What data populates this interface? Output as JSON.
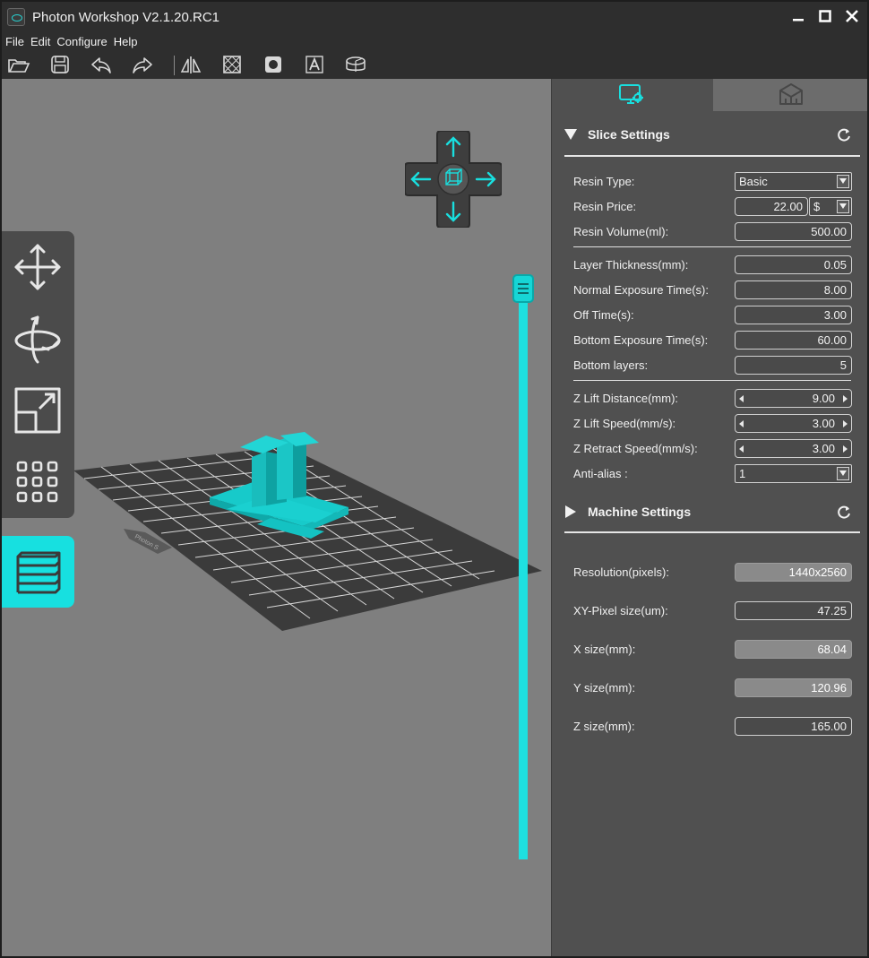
{
  "window": {
    "title": "Photon Workshop V2.1.20.RC1"
  },
  "menu": [
    "File",
    "Edit",
    "Configure",
    "Help"
  ],
  "toolbar": {
    "buttons": [
      "open-folder-icon",
      "save-icon",
      "undo-icon",
      "redo-icon",
      "mirror-icon",
      "hollow-icon",
      "punch-hole-icon",
      "text-icon",
      "slice-icon"
    ]
  },
  "viewport": {
    "plate_label": "Photon S",
    "accent": "#17e0e0",
    "left_tools": [
      "move-icon",
      "rotate-icon",
      "scale-icon",
      "layout-grid-icon",
      "layers-icon"
    ]
  },
  "panel": {
    "tabs": [
      "slice-settings-tab",
      "model-tab"
    ],
    "slice": {
      "title": "Slice Settings",
      "resin_type": {
        "label": "Resin Type:",
        "value": "Basic"
      },
      "resin_price": {
        "label": "Resin Price:",
        "value": "22.00",
        "currency": "$"
      },
      "resin_volume": {
        "label": "Resin Volume(ml):",
        "value": "500.00"
      },
      "layer_thickness": {
        "label": "Layer Thickness(mm):",
        "value": "0.05"
      },
      "normal_exposure": {
        "label": "Normal Exposure Time(s):",
        "value": "8.00"
      },
      "off_time": {
        "label": "Off Time(s):",
        "value": "3.00"
      },
      "bottom_exposure": {
        "label": "Bottom Exposure Time(s):",
        "value": "60.00"
      },
      "bottom_layers": {
        "label": "Bottom layers:",
        "value": "5"
      },
      "z_lift_distance": {
        "label": "Z Lift Distance(mm):",
        "value": "9.00"
      },
      "z_lift_speed": {
        "label": "Z Lift Speed(mm/s):",
        "value": "3.00"
      },
      "z_retract_speed": {
        "label": "Z Retract Speed(mm/s):",
        "value": "3.00"
      },
      "anti_alias": {
        "label": "Anti-alias :",
        "value": "1"
      }
    },
    "machine": {
      "title": "Machine Settings",
      "resolution": {
        "label": "Resolution(pixels):",
        "value": "1440x2560"
      },
      "xy_pixel": {
        "label": "XY-Pixel size(um):",
        "value": "47.25"
      },
      "x_size": {
        "label": "X size(mm):",
        "value": "68.04"
      },
      "y_size": {
        "label": "Y size(mm):",
        "value": "120.96"
      },
      "z_size": {
        "label": "Z size(mm):",
        "value": "165.00"
      }
    }
  }
}
